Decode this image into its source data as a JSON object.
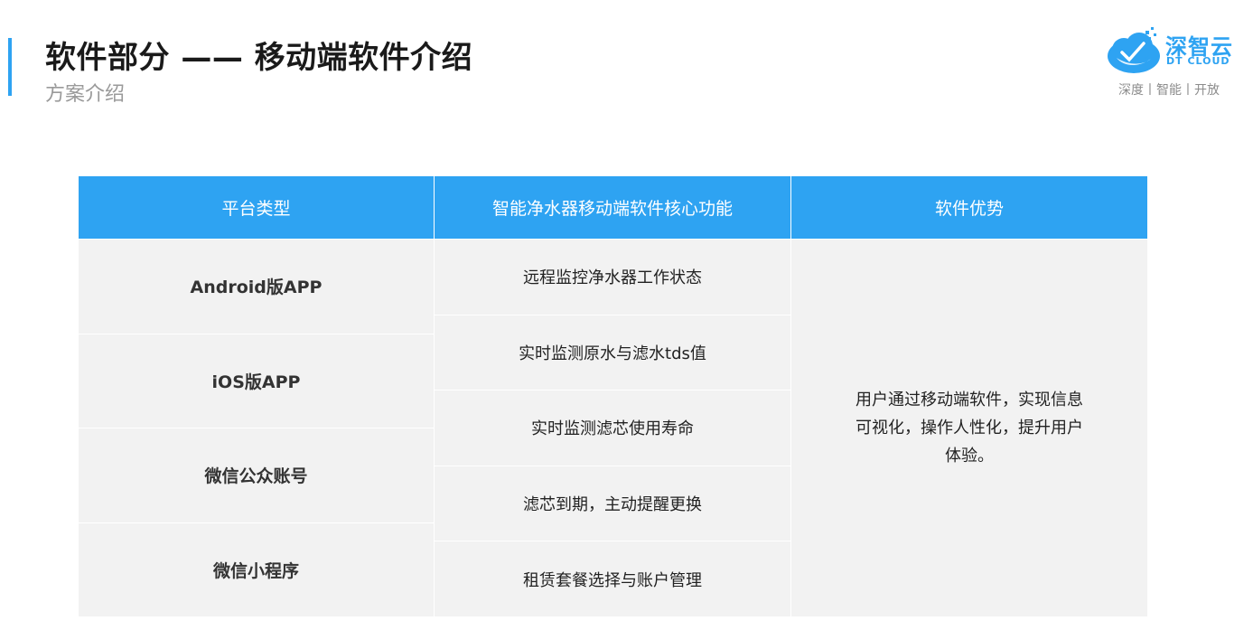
{
  "header": {
    "title": "软件部分 —— 移动端软件介绍",
    "subtitle": "方案介绍"
  },
  "logo": {
    "name_cn": "深智云",
    "name_en": "DT CLOUD",
    "slogan": "深度丨智能丨开放",
    "color": "#2ea3f2"
  },
  "table": {
    "headers": [
      "平台类型",
      "智能净水器移动端软件核心功能",
      "软件优势"
    ],
    "platforms": [
      "Android版APP",
      "iOS版APP",
      "微信公众账号",
      "微信小程序"
    ],
    "functions": [
      "远程监控净水器工作状态",
      "实时监测原水与滤水tds值",
      "实时监测滤芯使用寿命",
      "滤芯到期，主动提醒更换",
      "租赁套餐选择与账户管理"
    ],
    "advantage": "用户通过移动端软件，实现信息可视化，操作人性化，提升用户体验。",
    "header_color": "#2ea3f2",
    "cell_color": "#f2f2f2"
  }
}
